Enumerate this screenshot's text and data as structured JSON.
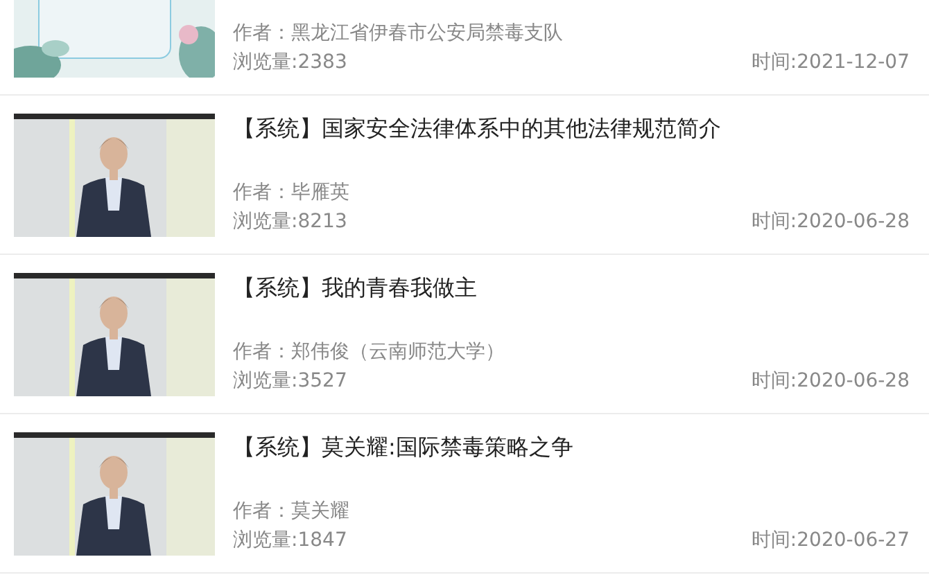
{
  "videos": [
    {
      "kind": "picture",
      "author": "作者：黑龙江省伊春市公安局禁毒支队",
      "views": "浏览量:2383",
      "time": "时间:2021-12-07"
    },
    {
      "kind": "picture",
      "title": "【系统】国家安全法律体系中的其他法律规范简介",
      "author": "作者：毕雁英",
      "views": "浏览量:8213",
      "time": "时间:2020-06-28"
    },
    {
      "kind": "picture",
      "title": "【系统】我的青春我做主",
      "author": "作者：郑伟俊（云南师范大学）",
      "views": "浏览量:3527",
      "time": "时间:2020-06-28"
    },
    {
      "kind": "picture",
      "title": "【系统】莫关耀:国际禁毒策略之争",
      "author": "作者：莫关耀",
      "views": "浏览量:1847",
      "time": "时间:2020-06-27"
    }
  ]
}
